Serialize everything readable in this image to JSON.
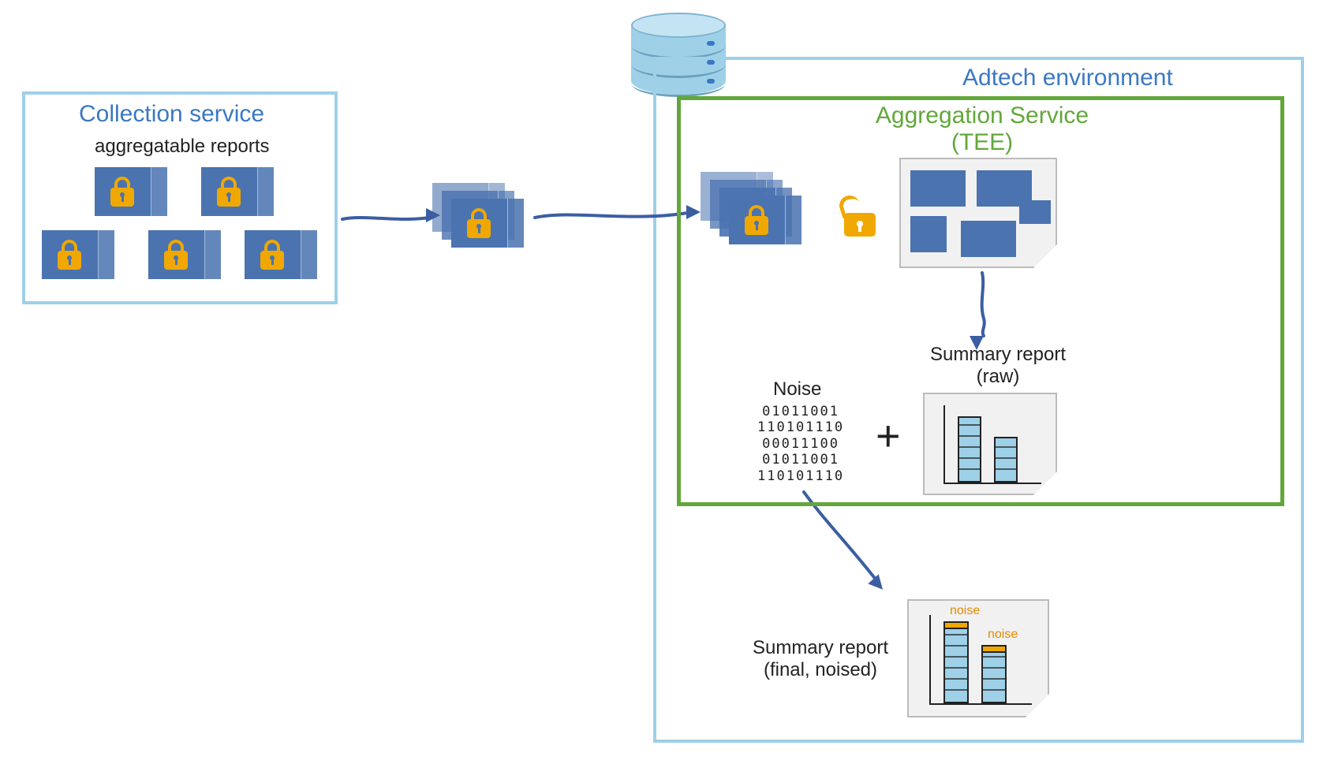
{
  "adtech_env_title": "Adtech environment",
  "collection": {
    "title": "Collection service",
    "subtitle": "aggregatable reports"
  },
  "tee": {
    "title": "Aggregation Service\n(TEE)"
  },
  "summary_raw": {
    "title": "Summary report\n(raw)"
  },
  "summary_final": {
    "title": "Summary report\n(final, noised)",
    "noise_label": "noise"
  },
  "noise": {
    "title": "Noise",
    "bits": "01011001\n110101110\n00011100\n01011001\n110101110"
  },
  "plus_sign": "+"
}
